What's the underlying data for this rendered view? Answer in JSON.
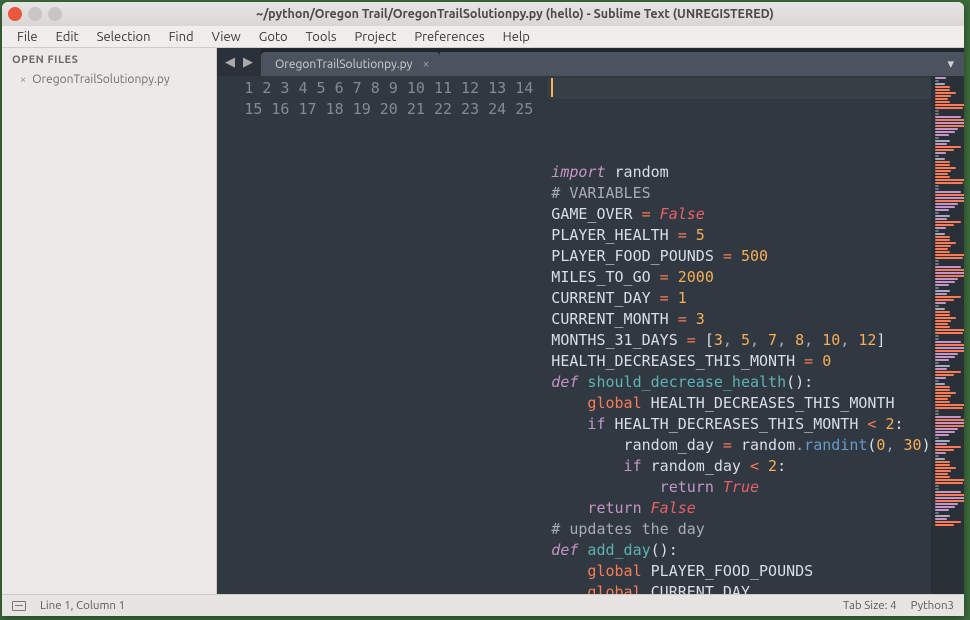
{
  "window": {
    "title": "~/python/Oregon Trail/OregonTrailSolutionpy.py (hello) - Sublime Text (UNREGISTERED)"
  },
  "menubar": [
    "File",
    "Edit",
    "Selection",
    "Find",
    "View",
    "Goto",
    "Tools",
    "Project",
    "Preferences",
    "Help"
  ],
  "sidebar": {
    "header": "OPEN FILES",
    "files": [
      {
        "name": "OregonTrailSolutionpy.py"
      }
    ]
  },
  "tabs": {
    "active": "OregonTrailSolutionpy.py"
  },
  "code": {
    "first_line": 1,
    "lines": [
      [
        [
          "kw-import",
          "import"
        ],
        [
          " "
        ],
        [
          "ident",
          "random"
        ]
      ],
      [],
      [
        [
          "comment",
          "# VARIABLES"
        ]
      ],
      [
        [
          "const-name",
          "GAME_OVER"
        ],
        [
          " "
        ],
        [
          "op",
          "="
        ],
        [
          " "
        ],
        [
          "bool",
          "False"
        ]
      ],
      [
        [
          "const-name",
          "PLAYER_HEALTH"
        ],
        [
          " "
        ],
        [
          "op",
          "="
        ],
        [
          " "
        ],
        [
          "num",
          "5"
        ]
      ],
      [
        [
          "const-name",
          "PLAYER_FOOD_POUNDS"
        ],
        [
          " "
        ],
        [
          "op",
          "="
        ],
        [
          " "
        ],
        [
          "num",
          "500"
        ]
      ],
      [
        [
          "const-name",
          "MILES_TO_GO"
        ],
        [
          " "
        ],
        [
          "op",
          "="
        ],
        [
          " "
        ],
        [
          "num",
          "2000"
        ]
      ],
      [
        [
          "const-name",
          "CURRENT_DAY"
        ],
        [
          " "
        ],
        [
          "op",
          "="
        ],
        [
          " "
        ],
        [
          "num",
          "1"
        ]
      ],
      [
        [
          "const-name",
          "CURRENT_MONTH"
        ],
        [
          " "
        ],
        [
          "op",
          "="
        ],
        [
          " "
        ],
        [
          "num",
          "3"
        ]
      ],
      [
        [
          "const-name",
          "MONTHS_31_DAYS"
        ],
        [
          " "
        ],
        [
          "op",
          "="
        ],
        [
          " "
        ],
        [
          "brack",
          "["
        ],
        [
          "num",
          "3"
        ],
        [
          "comma",
          ", "
        ],
        [
          "num",
          "5"
        ],
        [
          "comma",
          ", "
        ],
        [
          "num",
          "7"
        ],
        [
          "comma",
          ", "
        ],
        [
          "num",
          "8"
        ],
        [
          "comma",
          ", "
        ],
        [
          "num",
          "10"
        ],
        [
          "comma",
          ", "
        ],
        [
          "num",
          "12"
        ],
        [
          "brack",
          "]"
        ]
      ],
      [
        [
          "const-name",
          "HEALTH_DECREASES_THIS_MONTH"
        ],
        [
          " "
        ],
        [
          "op",
          "="
        ],
        [
          " "
        ],
        [
          "num",
          "0"
        ]
      ],
      [],
      [],
      [
        [
          "kw-def",
          "def"
        ],
        [
          " "
        ],
        [
          "func",
          "should_decrease_health"
        ],
        [
          "paren",
          "()"
        ],
        [
          "ident",
          ":"
        ]
      ],
      [
        [
          "",
          "    "
        ],
        [
          "kw-global",
          "global"
        ],
        [
          " "
        ],
        [
          "ident",
          "HEALTH_DECREASES_THIS_MONTH"
        ]
      ],
      [
        [
          "",
          "    "
        ],
        [
          "kw-flow",
          "if"
        ],
        [
          " "
        ],
        [
          "ident",
          "HEALTH_DECREASES_THIS_MONTH"
        ],
        [
          " "
        ],
        [
          "op",
          "<"
        ],
        [
          " "
        ],
        [
          "num",
          "2"
        ],
        [
          "ident",
          ":"
        ]
      ],
      [
        [
          "",
          "        "
        ],
        [
          "ident",
          "random_day"
        ],
        [
          " "
        ],
        [
          "op",
          "="
        ],
        [
          " "
        ],
        [
          "ident",
          "random"
        ],
        [
          "dot",
          "."
        ],
        [
          "call",
          "randint"
        ],
        [
          "paren",
          "("
        ],
        [
          "num",
          "0"
        ],
        [
          "comma",
          ", "
        ],
        [
          "num",
          "30"
        ],
        [
          "paren",
          ")"
        ]
      ],
      [
        [
          "",
          "        "
        ],
        [
          "kw-flow",
          "if"
        ],
        [
          " "
        ],
        [
          "ident",
          "random_day"
        ],
        [
          " "
        ],
        [
          "op",
          "<"
        ],
        [
          " "
        ],
        [
          "num",
          "2"
        ],
        [
          "ident",
          ":"
        ]
      ],
      [
        [
          "",
          "            "
        ],
        [
          "kw-return",
          "return"
        ],
        [
          " "
        ],
        [
          "bool",
          "True"
        ]
      ],
      [
        [
          "",
          "    "
        ],
        [
          "kw-return",
          "return"
        ],
        [
          " "
        ],
        [
          "bool",
          "False"
        ]
      ],
      [],
      [
        [
          "comment",
          "# updates the day"
        ]
      ],
      [
        [
          "kw-def",
          "def"
        ],
        [
          " "
        ],
        [
          "func",
          "add_day"
        ],
        [
          "paren",
          "()"
        ],
        [
          "ident",
          ":"
        ]
      ],
      [
        [
          "",
          "    "
        ],
        [
          "kw-global",
          "global"
        ],
        [
          " "
        ],
        [
          "ident",
          "PLAYER_FOOD_POUNDS"
        ]
      ],
      [
        [
          "",
          "    "
        ],
        [
          "kw-global",
          "global"
        ],
        [
          " "
        ],
        [
          "ident",
          "CURRENT_DAY"
        ]
      ]
    ]
  },
  "statusbar": {
    "position": "Line 1, Column 1",
    "tab_size": "Tab Size: 4",
    "syntax": "Python3"
  },
  "icons": {
    "tab_left": "◀",
    "tab_right": "▶",
    "tab_close": "×",
    "file_close": "×",
    "dropdown": "▾"
  }
}
